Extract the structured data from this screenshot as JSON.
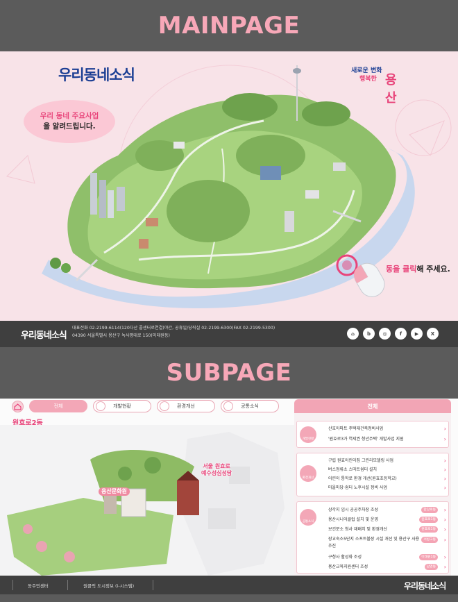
{
  "sections": {
    "main_title": "MAINPAGE",
    "sub_title": "SUBPAGE"
  },
  "main": {
    "logo": "우리동네소식",
    "gu_logo": {
      "line1": "새로운 변화",
      "line2": "행복한",
      "name": "용산"
    },
    "bubble": {
      "pink": "우리 동네 주요사업",
      "rest": "을 알려드립니다."
    },
    "click_hint": {
      "pink": "동을 클릭",
      "rest": "해 주세요."
    }
  },
  "footer": {
    "logo": "우리동네소식",
    "info_line1": "대표전화 02-2199-6114(120다산 콜센터로연결)야간, 공휴일/당직실 02-2199-6300(FAX 02-2199-5300)",
    "info_line2": "04390 서울특별시 용산구 녹사평대로 150(이태원동)",
    "sns": [
      "home-icon",
      "blog-icon",
      "instagram-icon",
      "facebook-icon",
      "youtube-icon",
      "x-icon"
    ],
    "sns_glyphs": [
      "⌂",
      "b",
      "◎",
      "f",
      "▶",
      "X"
    ]
  },
  "sub": {
    "tabs": [
      "전체",
      "개발현황",
      "환경개선",
      "공통소식"
    ],
    "village": "원효로2동",
    "map_labels": {
      "culture": "용산문화원",
      "church_line1": "서울 원효로",
      "church_line2": "예수성심성당"
    },
    "panel_title": "전체",
    "cards": [
      {
        "category": "개발현황",
        "items": [
          {
            "text": "산호아파트 주택재건축정비사업",
            "badge": ""
          },
          {
            "text": "'원효로3가 역세권 청년주택' 개발사업 지원",
            "badge": ""
          }
        ]
      },
      {
        "category": "환경개선",
        "items": [
          {
            "text": "구립 원효어린이집 그린리모델링 사업",
            "badge": ""
          },
          {
            "text": "버스정류소 스마트쉼터 설치",
            "badge": ""
          },
          {
            "text": "어린이 통학로 환경 개선(원효초등학교)",
            "badge": ""
          },
          {
            "text": "마을마당·쉼터 노후시설 정비 사업",
            "badge": ""
          }
        ]
      },
      {
        "category": "공통소식",
        "items": [
          {
            "text": "상각지 임시 공공주차장 조성",
            "badge": "한강로동"
          },
          {
            "text": "용산시니어클럽 설치 및 운영",
            "badge": "원효로1동"
          },
          {
            "text": "보건분소 청사 재배치 및 환경개선",
            "badge": "원효로1동"
          },
          {
            "text": "장교숙소5단지 소프트볼장 시설 개선 및 용산구 사용 추진",
            "badge": "서빙고동"
          },
          {
            "text": "구청사 활성화 조성",
            "badge": "이태원1동"
          },
          {
            "text": "용산교육지원센터 조성",
            "badge": "남영동"
          }
        ]
      }
    ]
  },
  "footer2": {
    "items": [
      "동주민센터",
      "원클릭 도시정보 (i-시스템)"
    ],
    "logo": "우리동네소식"
  }
}
